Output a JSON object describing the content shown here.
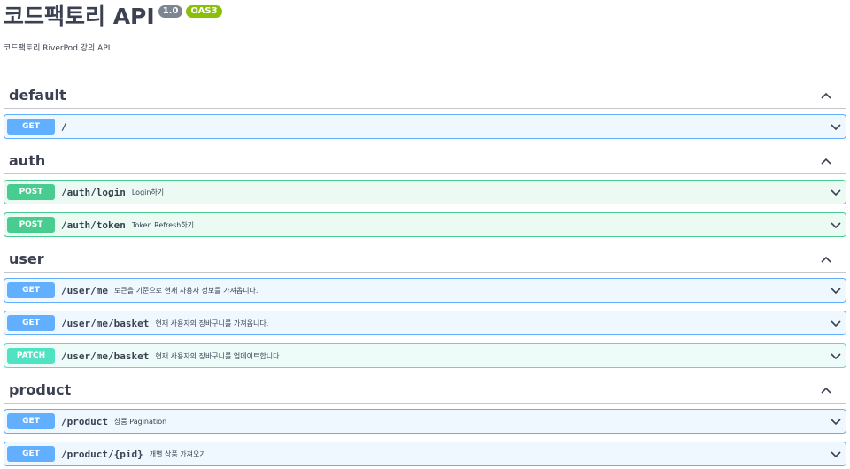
{
  "info": {
    "title": "코드팩토리 API",
    "version": "1.0",
    "oas": "OAS3",
    "description": "코드팩토리 RiverPod 강의 API"
  },
  "tags": [
    {
      "name": "default",
      "operations": [
        {
          "method": "GET",
          "path": "/",
          "summary": ""
        }
      ]
    },
    {
      "name": "auth",
      "operations": [
        {
          "method": "POST",
          "path": "/auth/login",
          "summary": "Login하기"
        },
        {
          "method": "POST",
          "path": "/auth/token",
          "summary": "Token Refresh하기"
        }
      ]
    },
    {
      "name": "user",
      "operations": [
        {
          "method": "GET",
          "path": "/user/me",
          "summary": "토큰을 기준으로 현재 사용자 정보를 가져옵니다."
        },
        {
          "method": "GET",
          "path": "/user/me/basket",
          "summary": "현재 사용자의 장바구니를 가져옵니다."
        },
        {
          "method": "PATCH",
          "path": "/user/me/basket",
          "summary": "현재 사용자의 장바구니를 업데이트합니다."
        }
      ]
    },
    {
      "name": "product",
      "operations": [
        {
          "method": "GET",
          "path": "/product",
          "summary": "상품 Pagination"
        },
        {
          "method": "GET",
          "path": "/product/{pid}",
          "summary": "개별 상품 가져오기"
        }
      ]
    }
  ],
  "colors": {
    "get": "#61affe",
    "post": "#49cc90",
    "patch": "#50e3c2",
    "version_badge": "#7d8492",
    "oas_badge": "#89bf04"
  },
  "icons": {
    "section_toggle": "chevron-up-icon",
    "operation_toggle": "chevron-down-icon"
  }
}
